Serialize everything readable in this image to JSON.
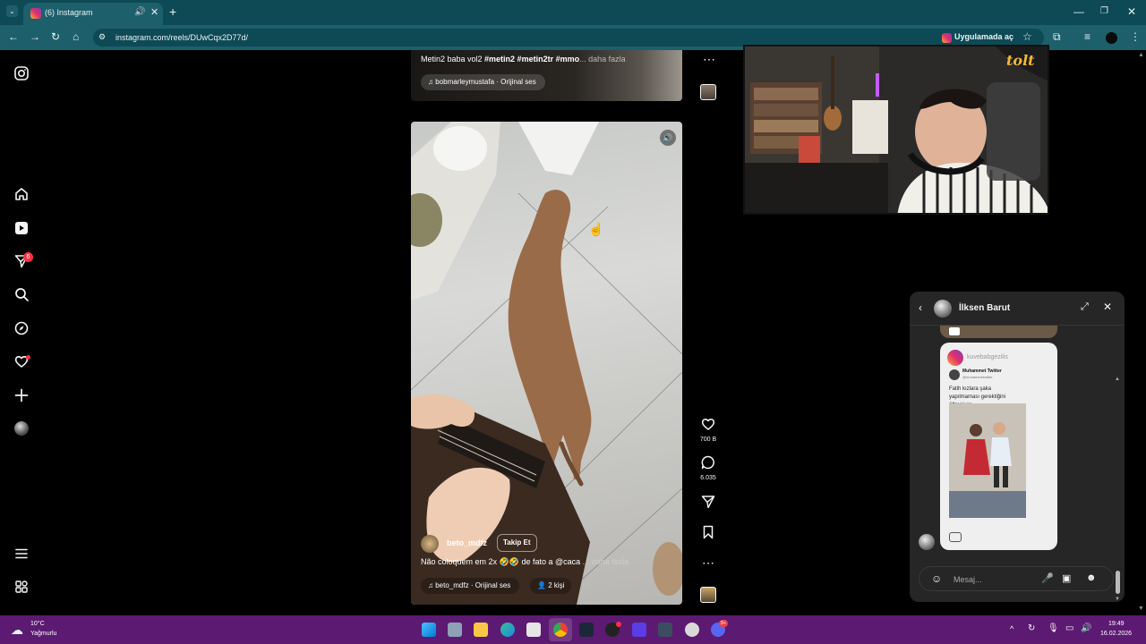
{
  "browser": {
    "tab_title": "(6) Instagram",
    "new_tab": "+",
    "url": "instagram.com/reels/DUwCqx2D77d/",
    "open_in_app": "Uygulamada aç"
  },
  "reels": {
    "previous": {
      "caption_plain": "Metin2 baba vol2 ",
      "caption_tags": "#metin2 #metin2tr #mmo",
      "more": "... daha fazla",
      "audio": "bobmarleymustafa · Orijinal ses"
    },
    "current": {
      "username": "beto_mdfz",
      "follow": "Takip Et",
      "caption": "Não coloquem em 2x 🤣🤣 de fato a @caca",
      "more": "... daha fazla",
      "audio": "beto_mdfz · Orijinal ses",
      "people": "2 kişi",
      "likes": "700 B",
      "comments": "6.035"
    }
  },
  "sidebar": {
    "notification_count": "6"
  },
  "chat": {
    "contact_name": "İlksen Barut",
    "shared_post_account": "kuvebabgezilis",
    "shared_tweet_name": "Muhammet Twitter",
    "shared_tweet_handle": "@muhammetwitter",
    "shared_tweet_text": "Fatih kızlara şaka yapılmaması gerektiğini öğreniyor",
    "message_placeholder": "Mesaj..."
  },
  "stream_overlay": {
    "logo_text": "tolt"
  },
  "taskbar": {
    "weather_temp": "10°C",
    "weather_desc": "Yağmurlu",
    "time": "19:49",
    "date": "16.02.2026",
    "discord_badge": "9+"
  }
}
